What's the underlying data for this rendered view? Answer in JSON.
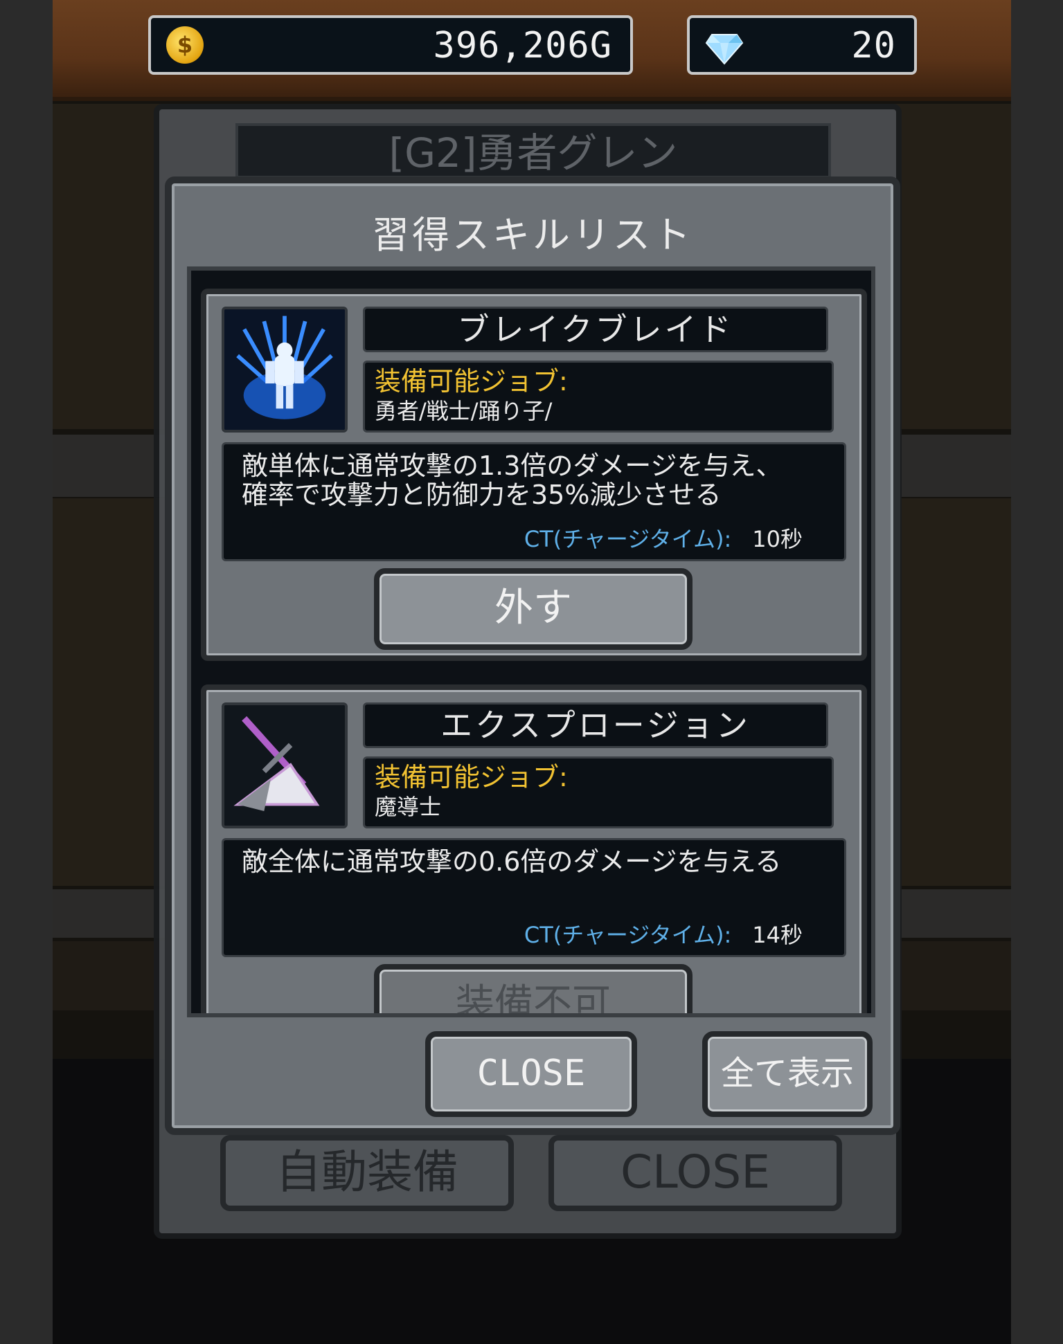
{
  "currency": {
    "gold": "396,206G",
    "gems": "20",
    "gold_icon": "coin-icon",
    "gem_icon": "diamond-icon"
  },
  "background": {
    "character_title": "[G2]勇者グレン",
    "auto_equip_label": "自動装備",
    "close_label": "CLOSE"
  },
  "modal": {
    "title": "習得スキルリスト",
    "skills": [
      {
        "name": "ブレイクブレイド",
        "job_label": "装備可能ジョブ:",
        "jobs": "勇者/戦士/踊り子/",
        "desc_line1": "敵単体に通常攻撃の1.3倍のダメージを与え、",
        "desc_line2": "確率で攻撃力と防御力を35%減少させる",
        "ct_label": "CT(チャージタイム):",
        "ct_value": "10秒",
        "action": "外す"
      },
      {
        "name": "エクスプロージョン",
        "job_label": "装備可能ジョブ:",
        "jobs": "魔導士",
        "desc_line1": "敵全体に通常攻撃の0.6倍のダメージを与える",
        "desc_line2": "",
        "ct_label": "CT(チャージタイム):",
        "ct_value": "14秒",
        "action": "装備不可"
      }
    ],
    "close_label": "CLOSE",
    "show_all_label": "全て表示"
  },
  "colors": {
    "job_label": "#f1c232",
    "ct_label": "#5fb0e8",
    "panel": "#6b7075"
  }
}
